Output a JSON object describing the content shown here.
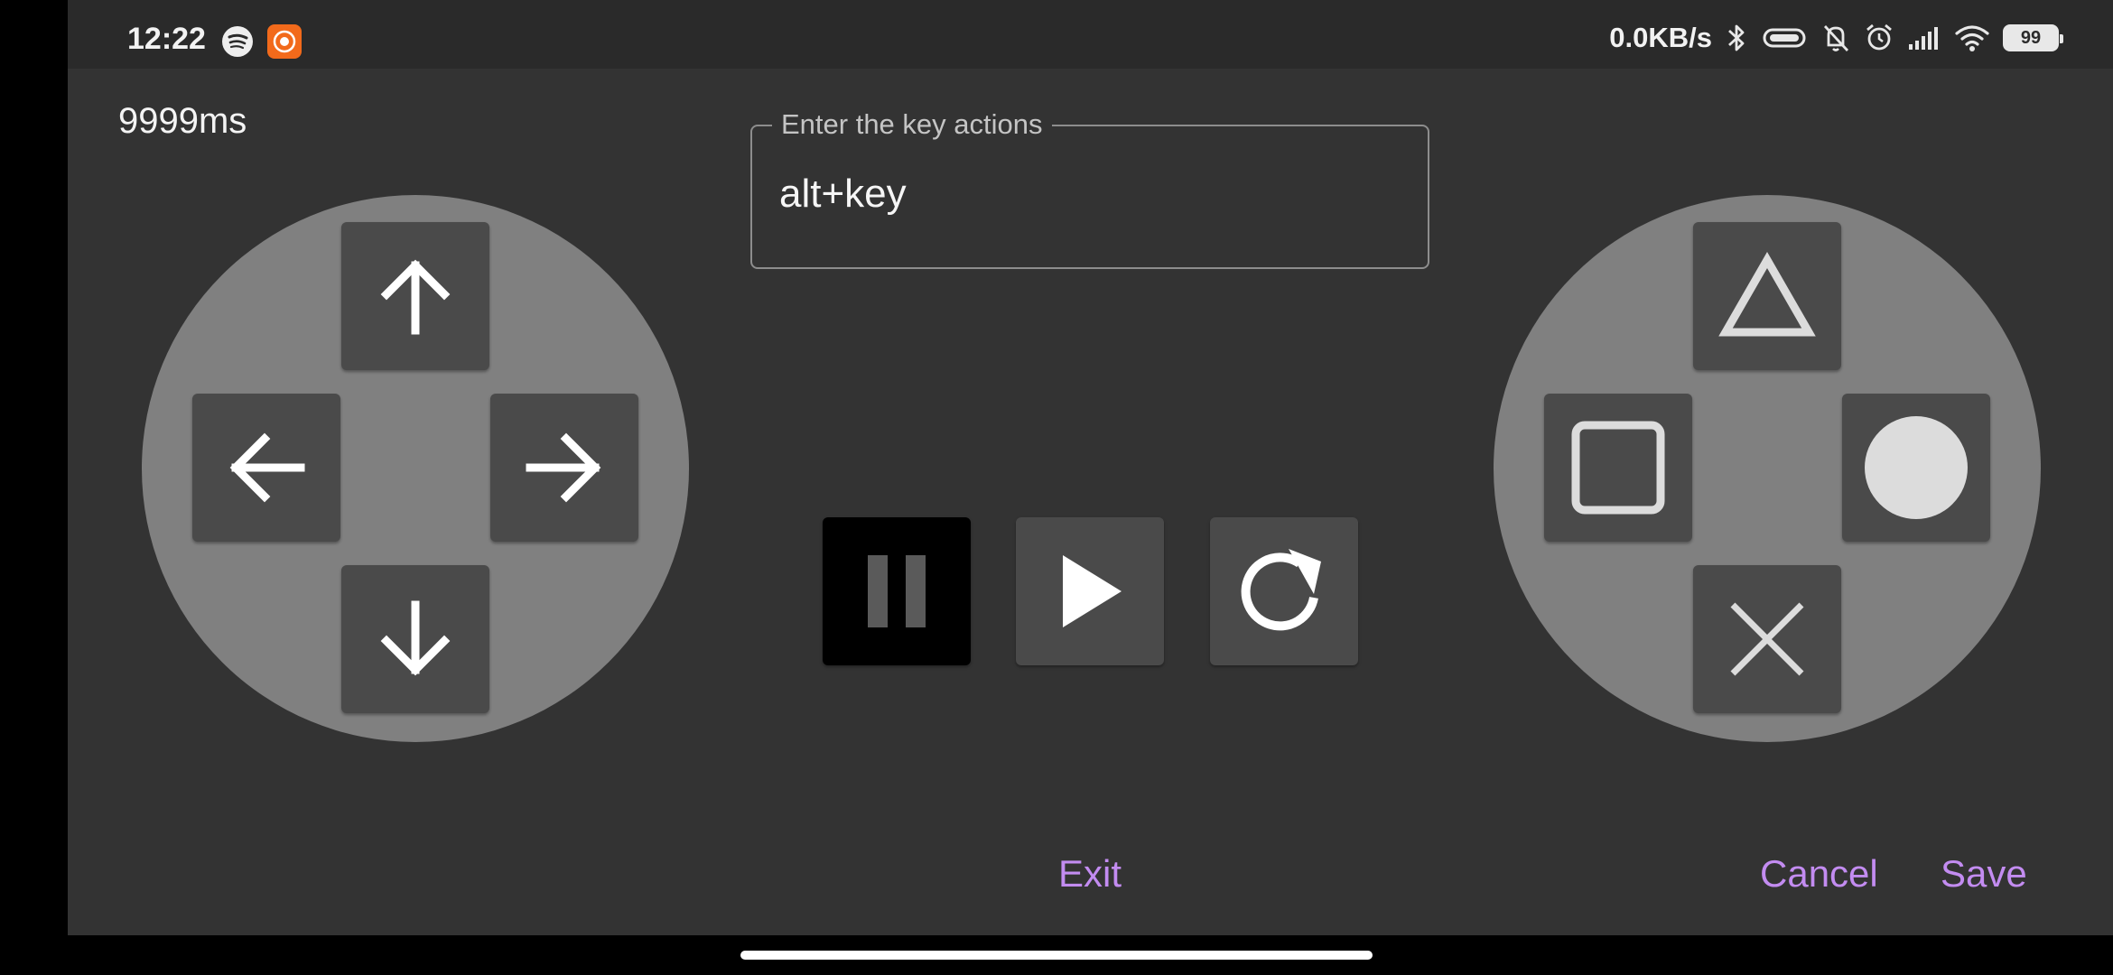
{
  "status_bar": {
    "time": "12:22",
    "net_speed": "0.0KB/s",
    "battery": "99",
    "icons": [
      "spotify-icon",
      "screen-record-icon",
      "bluetooth-icon",
      "vibrate-icon",
      "mute-icon",
      "alarm-icon",
      "signal-icon",
      "wifi-icon",
      "battery-icon"
    ]
  },
  "delay": "9999ms",
  "key_field": {
    "label": "Enter the key actions",
    "value": "alt+key"
  },
  "left_pad": {
    "icons": [
      "arrow-up-icon",
      "arrow-left-icon",
      "arrow-right-icon",
      "arrow-down-icon"
    ]
  },
  "right_pad": {
    "icons": [
      "triangle-icon",
      "square-icon",
      "circle-icon",
      "cross-icon"
    ]
  },
  "controls": {
    "icons": [
      "pause-icon",
      "play-icon",
      "replay-icon"
    ]
  },
  "actions": {
    "exit": "Exit",
    "cancel": "Cancel",
    "save": "Save"
  },
  "colors": {
    "background": "#333333",
    "pad": "#808080",
    "button": "#4a4a4a",
    "accent": "#c38cf1"
  }
}
